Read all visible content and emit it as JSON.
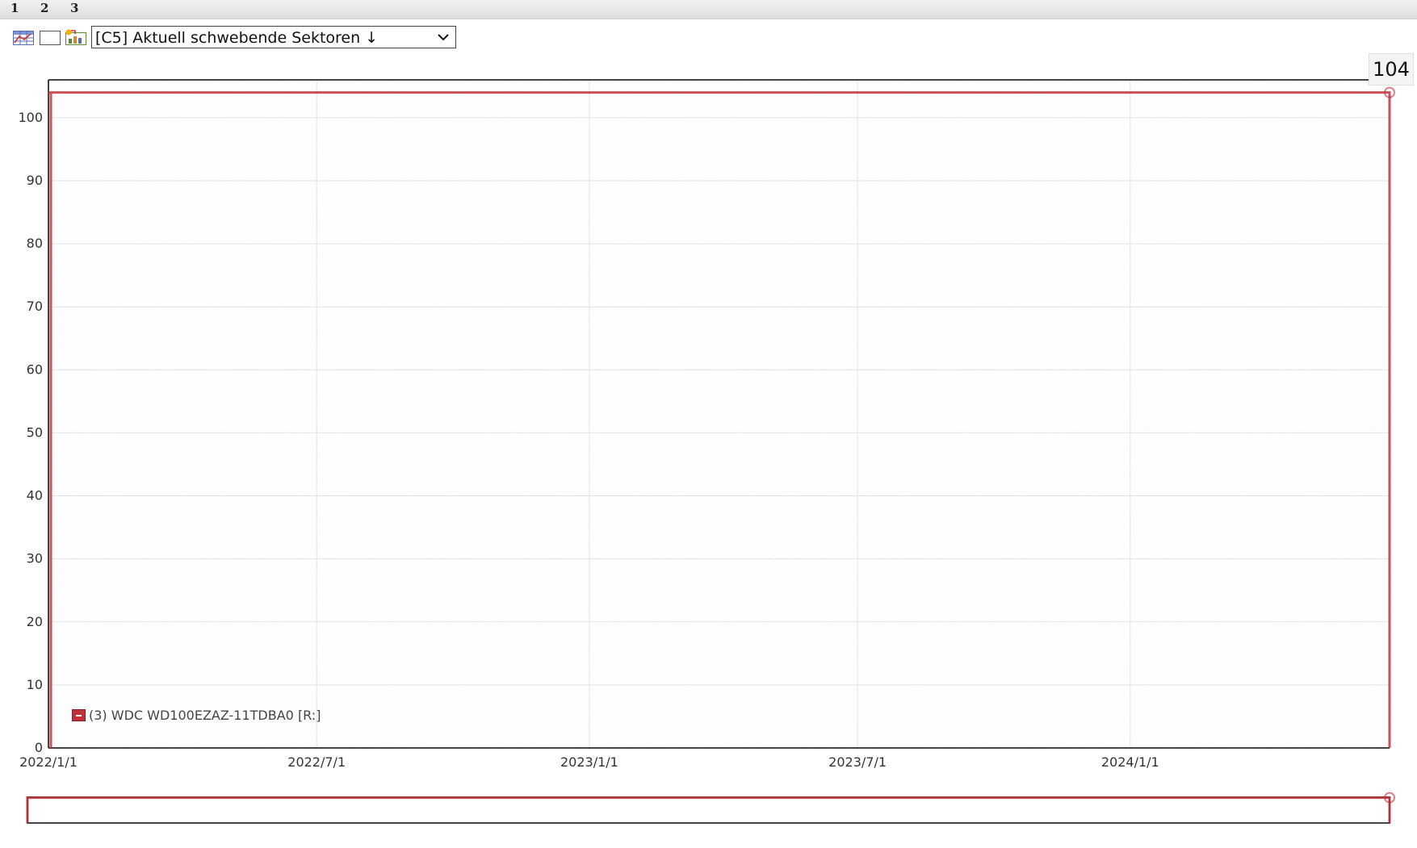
{
  "tabs": [
    "1",
    "2",
    "3"
  ],
  "toolbar": {
    "icons": [
      "table-chart-icon",
      "blank-panel-icon",
      "export-chart-icon"
    ],
    "select": {
      "value": "[C5] Aktuell schwebende Sektoren ↓"
    }
  },
  "tooltip": {
    "value": "104"
  },
  "colors": {
    "series": "#c0323a",
    "grid": "#e2e2e2",
    "axis": "#444444"
  },
  "chart_data": {
    "type": "line",
    "y_ticks": [
      "0",
      "10",
      "20",
      "30",
      "40",
      "50",
      "60",
      "70",
      "80",
      "90",
      "100"
    ],
    "x_ticks": [
      "2022/1/1",
      "2022/7/1",
      "2023/1/1",
      "2023/7/1",
      "2024/1/1"
    ],
    "ylim": [
      0,
      106
    ],
    "xlim": [
      "2022-01-01",
      "2024-06-24"
    ],
    "grid": true,
    "legend_position": "bottom-left",
    "series": [
      {
        "name": "(3) WDC WD100EZAZ-11TDBA0 [R:]",
        "points": [
          {
            "x": "2022-01-01",
            "y": 104
          },
          {
            "x": "2024-06-24",
            "y": 104
          }
        ]
      }
    ]
  }
}
